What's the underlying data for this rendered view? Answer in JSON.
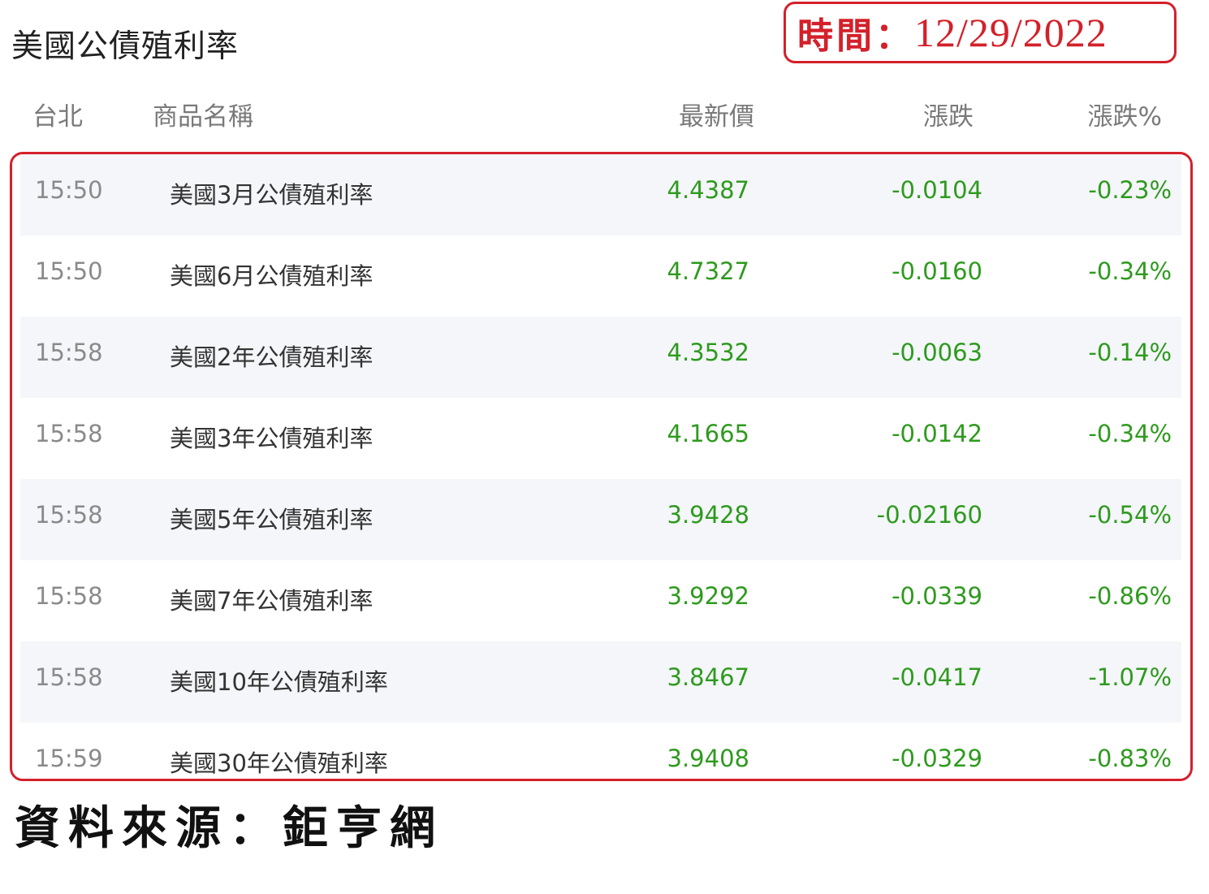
{
  "title": "美國公債殖利率",
  "date_label": "時間：",
  "date_value": "12/29/2022",
  "headers": {
    "time": "台北",
    "name": "商品名稱",
    "price": "最新價",
    "change": "漲跌",
    "change_pct": "漲跌%"
  },
  "rows": [
    {
      "time": "15:50",
      "name": "美國3月公債殖利率",
      "price": "4.4387",
      "change": "-0.0104",
      "change_pct": "-0.23%"
    },
    {
      "time": "15:50",
      "name": "美國6月公債殖利率",
      "price": "4.7327",
      "change": "-0.0160",
      "change_pct": "-0.34%"
    },
    {
      "time": "15:58",
      "name": "美國2年公債殖利率",
      "price": "4.3532",
      "change": "-0.0063",
      "change_pct": "-0.14%"
    },
    {
      "time": "15:58",
      "name": "美國3年公債殖利率",
      "price": "4.1665",
      "change": "-0.0142",
      "change_pct": "-0.34%"
    },
    {
      "time": "15:58",
      "name": "美國5年公債殖利率",
      "price": "3.9428",
      "change": "-0.02160",
      "change_pct": "-0.54%"
    },
    {
      "time": "15:58",
      "name": "美國7年公債殖利率",
      "price": "3.9292",
      "change": "-0.0339",
      "change_pct": "-0.86%"
    },
    {
      "time": "15:58",
      "name": "美國10年公債殖利率",
      "price": "3.8467",
      "change": "-0.0417",
      "change_pct": "-1.07%"
    },
    {
      "time": "15:59",
      "name": "美國30年公債殖利率",
      "price": "3.9408",
      "change": "-0.0329",
      "change_pct": "-0.83%"
    }
  ],
  "source": "資料來源：鉅亨網",
  "colors": {
    "down": "#2e9a1e",
    "highlight": "#d4202a"
  }
}
